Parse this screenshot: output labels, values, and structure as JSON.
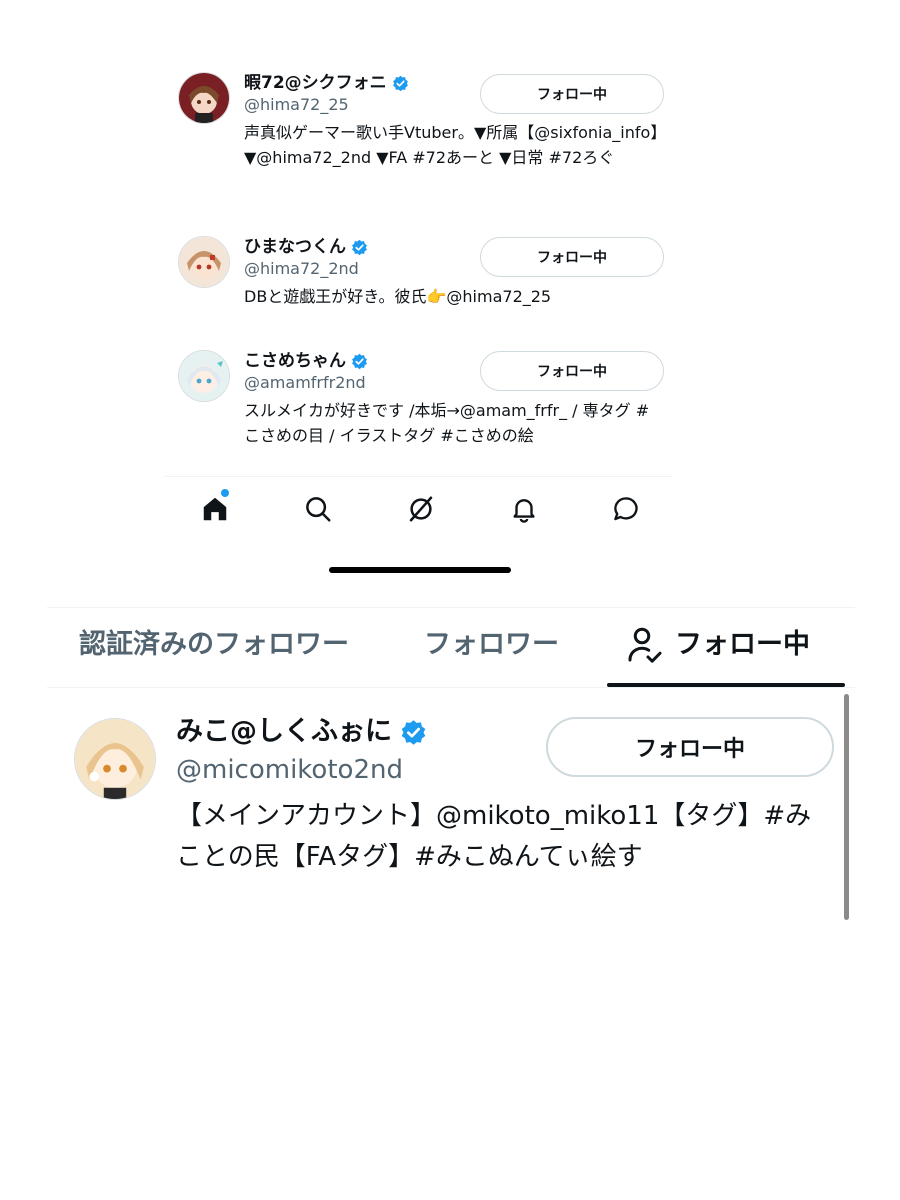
{
  "users": [
    {
      "name": "暇72@シクフォニ",
      "handle": "@hima72_25",
      "bio": "声真似ゲーマー歌い手Vtuber。▼所属【@sixfonia_info】▼@hima72_2nd ▼FA #72あーと ▼日常 #72ろぐ",
      "follow_label": "フォロー中"
    },
    {
      "name": "ひまなつくん",
      "handle": "@hima72_2nd",
      "bio": "DBと遊戯王が好き。彼氏👉@hima72_25",
      "follow_label": "フォロー中"
    },
    {
      "name": "こさめちゃん",
      "handle": "@amamfrfr2nd",
      "bio": "スルメイカが好きです /本垢→@amam_frfr_ / 専タグ #こさめの目 / イラストタグ #こさめの絵",
      "follow_label": "フォロー中"
    }
  ],
  "bottom_nav": {
    "icons": [
      "home-icon",
      "search-icon",
      "grok-icon",
      "bell-icon",
      "message-icon"
    ],
    "home_notification_dot": true
  },
  "tabs": [
    {
      "label": "認証済みのフォロワー",
      "active": false
    },
    {
      "label": "フォロワー",
      "active": false
    },
    {
      "label": "フォロー中",
      "active": true,
      "icon": "person-check-icon"
    }
  ],
  "featured_user": {
    "name": "みこ@しくふぉに",
    "handle": "@micomikoto2nd",
    "bio": "【メインアカウント】@mikoto_miko11【タグ】#みことの民【FAタグ】#みこぬんてぃ絵す",
    "follow_label": "フォロー中"
  },
  "colors": {
    "verified": "#1d9bf0",
    "text_primary": "#0f1419",
    "text_secondary": "#536471",
    "border": "#cfd9de"
  }
}
